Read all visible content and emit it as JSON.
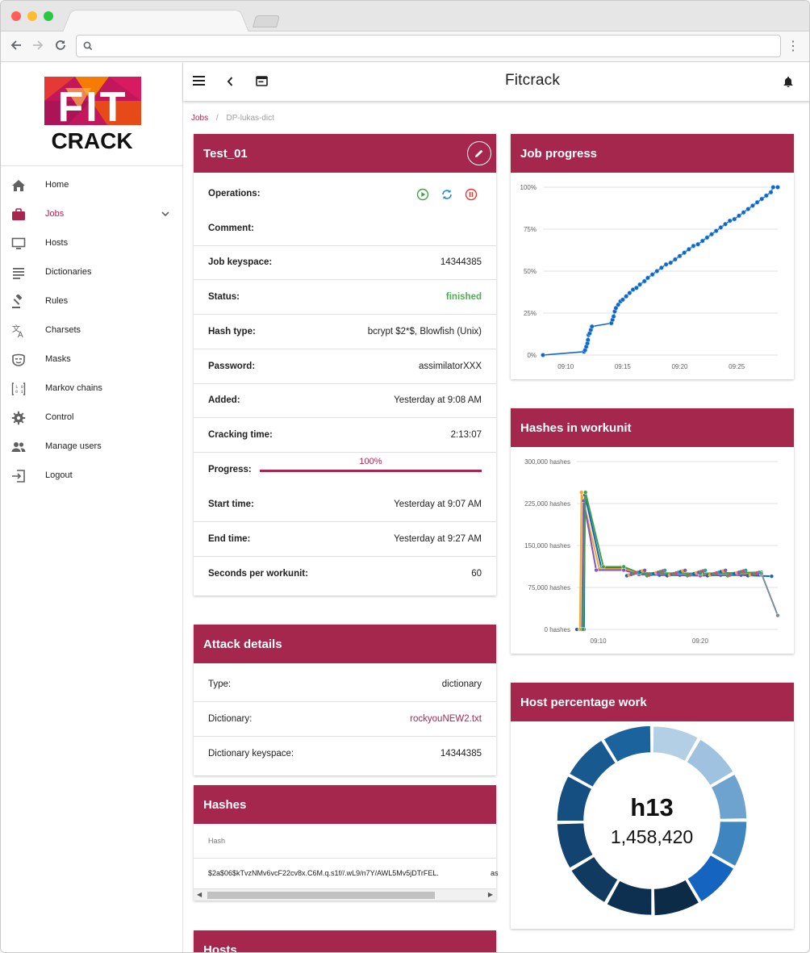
{
  "app_title": "Fitcrack",
  "logo": {
    "text_top": "FIT",
    "text_bottom": "CRACK"
  },
  "sidebar": {
    "items": [
      {
        "label": "Home",
        "icon": "home-icon",
        "active": false
      },
      {
        "label": "Jobs",
        "icon": "briefcase-icon",
        "active": true
      },
      {
        "label": "Hosts",
        "icon": "monitor-icon",
        "active": false
      },
      {
        "label": "Dictionaries",
        "icon": "list-icon",
        "active": false
      },
      {
        "label": "Rules",
        "icon": "gavel-icon",
        "active": false
      },
      {
        "label": "Charsets",
        "icon": "translate-icon",
        "active": false
      },
      {
        "label": "Masks",
        "icon": "mask-icon",
        "active": false
      },
      {
        "label": "Markov chains",
        "icon": "binary-icon",
        "active": false
      },
      {
        "label": "Control",
        "icon": "gear-icon",
        "active": false
      },
      {
        "label": "Manage users",
        "icon": "users-icon",
        "active": false
      },
      {
        "label": "Logout",
        "icon": "logout-icon",
        "active": false
      }
    ]
  },
  "breadcrumb": {
    "root": "Jobs",
    "separator": "/",
    "current": "DP-lukas-dict"
  },
  "job": {
    "title": "Test_01",
    "rows": [
      {
        "key": "Operations:",
        "value": ""
      },
      {
        "key": "Comment:",
        "value": ""
      },
      {
        "key": "Job keyspace:",
        "value": "14344385"
      },
      {
        "key": "Status:",
        "value": "finished"
      },
      {
        "key": "Hash type:",
        "value": "bcrypt $2*$, Blowfish (Unix)"
      },
      {
        "key": "Password:",
        "value": "assimilatorXXX"
      },
      {
        "key": "Added:",
        "value": "Yesterday at 9:08 AM"
      },
      {
        "key": "Cracking time:",
        "value": "2:13:07"
      },
      {
        "key": "Progress:",
        "value": "100%"
      },
      {
        "key": "Start time:",
        "value": "Yesterday at 9:07 AM"
      },
      {
        "key": "End time:",
        "value": "Yesterday at 9:27 AM"
      },
      {
        "key": "Seconds per workunit:",
        "value": "60"
      }
    ],
    "progress": 1.0,
    "status_color": "#4caf50"
  },
  "attack": {
    "title": "Attack details",
    "rows": [
      {
        "key": "Type:",
        "value": "dictionary"
      },
      {
        "key": "Dictionary:",
        "value": "rockyouNEW2.txt"
      },
      {
        "key": "Dictionary keyspace:",
        "value": "14344385"
      }
    ]
  },
  "hashes": {
    "title": "Hashes",
    "column": "Hash",
    "rows": [
      {
        "hash": "$2a$06$kTvzNMv6vcF22cv8x.C6M.q.s1f//.wL9/n7Y/AWL5Mv5jDTrFEL.",
        "extra": "as"
      }
    ]
  },
  "hosts_card": {
    "title": "Hosts"
  },
  "colors": {
    "accent": "#a6274d",
    "chart_blue": "#1565c0"
  },
  "chart_data": [
    {
      "type": "scatter",
      "title": "Job progress",
      "xlabel": "",
      "ylabel": "",
      "x_ticks": [
        "09:10",
        "09:15",
        "09:20",
        "09:25"
      ],
      "y_ticks": [
        "0%",
        "25%",
        "50%",
        "75%",
        "100%"
      ],
      "ylim": [
        0,
        100
      ],
      "xlim": [
        8.0,
        28.6
      ],
      "grid": true,
      "series": [
        {
          "values": [
            [
              8.0,
              0
            ],
            [
              11.6,
              2
            ],
            [
              11.7,
              3
            ],
            [
              11.8,
              5
            ],
            [
              11.9,
              7
            ],
            [
              11.95,
              9
            ],
            [
              12.0,
              12
            ],
            [
              12.1,
              13
            ],
            [
              12.2,
              15
            ],
            [
              12.3,
              17
            ],
            [
              14.0,
              19
            ],
            [
              14.1,
              21
            ],
            [
              14.2,
              23
            ],
            [
              14.3,
              26
            ],
            [
              14.4,
              28
            ],
            [
              14.6,
              30
            ],
            [
              14.8,
              32
            ],
            [
              15.0,
              33
            ],
            [
              15.3,
              35
            ],
            [
              15.6,
              37
            ],
            [
              15.9,
              39
            ],
            [
              16.2,
              40
            ],
            [
              16.5,
              42
            ],
            [
              16.9,
              44
            ],
            [
              17.2,
              46
            ],
            [
              17.6,
              48
            ],
            [
              18.0,
              50
            ],
            [
              18.4,
              52
            ],
            [
              18.8,
              54
            ],
            [
              19.2,
              55
            ],
            [
              19.6,
              57
            ],
            [
              20.0,
              59
            ],
            [
              20.4,
              61
            ],
            [
              20.8,
              63
            ],
            [
              21.2,
              65
            ],
            [
              21.6,
              66
            ],
            [
              22.0,
              68
            ],
            [
              22.4,
              70
            ],
            [
              22.8,
              72
            ],
            [
              23.2,
              74
            ],
            [
              23.6,
              76
            ],
            [
              24.0,
              78
            ],
            [
              24.4,
              80
            ],
            [
              24.8,
              81
            ],
            [
              25.2,
              83
            ],
            [
              25.6,
              85
            ],
            [
              26.0,
              87
            ],
            [
              26.4,
              89
            ],
            [
              26.8,
              91
            ],
            [
              27.2,
              93
            ],
            [
              27.6,
              95
            ],
            [
              28.0,
              97
            ],
            [
              28.2,
              100
            ],
            [
              28.6,
              100
            ]
          ]
        }
      ]
    },
    {
      "type": "line",
      "title": "Hashes in workunit",
      "x_ticks": [
        "09:10",
        "09:20"
      ],
      "y_ticks": [
        "0 hashes",
        "75,000 hashes",
        "150,000 hashes",
        "225,000 hashes",
        "300,000 hashes"
      ],
      "ylim": [
        0,
        300000
      ],
      "xlim": [
        7.9,
        27.6
      ],
      "grid": true,
      "series": [
        {
          "color": "#1565c0",
          "values": [
            [
              7.9,
              0
            ],
            [
              8.6,
              0
            ],
            [
              8.7,
              240000
            ],
            [
              10.3,
              110000
            ],
            [
              12.5,
              110000
            ],
            [
              14,
              100000
            ],
            [
              16,
              97000
            ],
            [
              18,
              97000
            ],
            [
              20,
              97000
            ],
            [
              22,
              97000
            ],
            [
              24,
              97000
            ],
            [
              27,
              95000
            ]
          ]
        },
        {
          "color": "#f9a825",
          "values": [
            [
              8.2,
              0
            ],
            [
              8.35,
              245000
            ],
            [
              10.1,
              108000
            ],
            [
              12.5,
              108000
            ],
            [
              14,
              100000
            ],
            [
              20,
              99000
            ],
            [
              26,
              100000
            ]
          ]
        },
        {
          "color": "#7e57c2",
          "values": [
            [
              8.4,
              0
            ],
            [
              8.55,
              230000
            ],
            [
              9.8,
              106000
            ],
            [
              12.5,
              106000
            ],
            [
              14,
              98000
            ],
            [
              20,
              96000
            ],
            [
              26,
              98000
            ]
          ]
        },
        {
          "color": "#43a047",
          "values": [
            [
              8.5,
              0
            ],
            [
              8.75,
              245000
            ],
            [
              10.5,
              112000
            ],
            [
              12.5,
              112000
            ],
            [
              14,
              101000
            ],
            [
              20,
              100000
            ],
            [
              26,
              102000
            ]
          ]
        },
        {
          "color": "#78909c",
          "values": [
            [
              26,
              100000
            ],
            [
              27.6,
              25000
            ]
          ]
        }
      ]
    },
    {
      "type": "pie",
      "title": "Host percentage work",
      "center_label": "h13",
      "center_value": "1,458,420",
      "slices": [
        {
          "value": 8.3,
          "color": "#b3cfe6"
        },
        {
          "value": 8.3,
          "color": "#9ec2e0"
        },
        {
          "value": 8.3,
          "color": "#6ea3cf"
        },
        {
          "value": 8.3,
          "color": "#3f86c0"
        },
        {
          "value": 8.3,
          "color": "#1565c0"
        },
        {
          "value": 8.3,
          "color": "#0b2b47"
        },
        {
          "value": 8.3,
          "color": "#0d3050"
        },
        {
          "value": 8.3,
          "color": "#103a60"
        },
        {
          "value": 8.3,
          "color": "#134370"
        },
        {
          "value": 8.3,
          "color": "#154e80"
        },
        {
          "value": 8.3,
          "color": "#185a8f"
        },
        {
          "value": 8.7,
          "color": "#1b639c"
        }
      ]
    }
  ]
}
